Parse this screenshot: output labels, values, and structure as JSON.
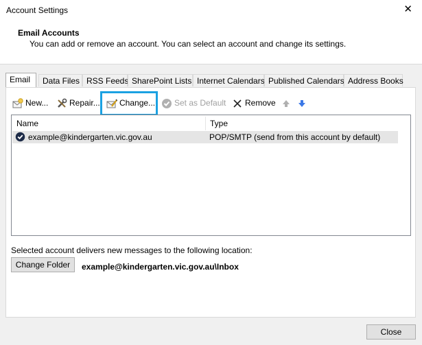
{
  "window": {
    "title": "Account Settings",
    "close_glyph": "✕"
  },
  "header": {
    "title": "Email Accounts",
    "description": "You can add or remove an account. You can select an account and change its settings."
  },
  "tabs": [
    {
      "label": "Email",
      "active": true
    },
    {
      "label": "Data Files"
    },
    {
      "label": "RSS Feeds"
    },
    {
      "label": "SharePoint Lists"
    },
    {
      "label": "Internet Calendars"
    },
    {
      "label": "Published Calendars"
    },
    {
      "label": "Address Books"
    }
  ],
  "toolbar": {
    "new_label": "New...",
    "repair_label": "Repair...",
    "change_label": "Change...",
    "set_default_label": "Set as Default",
    "remove_label": "Remove",
    "move_up_icon": "arrow-up-icon",
    "move_down_icon": "arrow-down-icon"
  },
  "accounts_table": {
    "columns": [
      "Name",
      "Type"
    ],
    "rows": [
      {
        "name": "example@kindergarten.vic.gov.au",
        "type": "POP/SMTP (send from this account by default)",
        "selected": true
      }
    ]
  },
  "delivery": {
    "text": "Selected account delivers new messages to the following location:",
    "change_folder_label": "Change Folder",
    "location": "example@kindergarten.vic.gov.au\\Inbox"
  },
  "footer": {
    "close_label": "Close"
  },
  "colors": {
    "highlight": "#1ba1e2",
    "row_selected": "#e5e5e5",
    "arrow_blue": "#3b78e7"
  }
}
